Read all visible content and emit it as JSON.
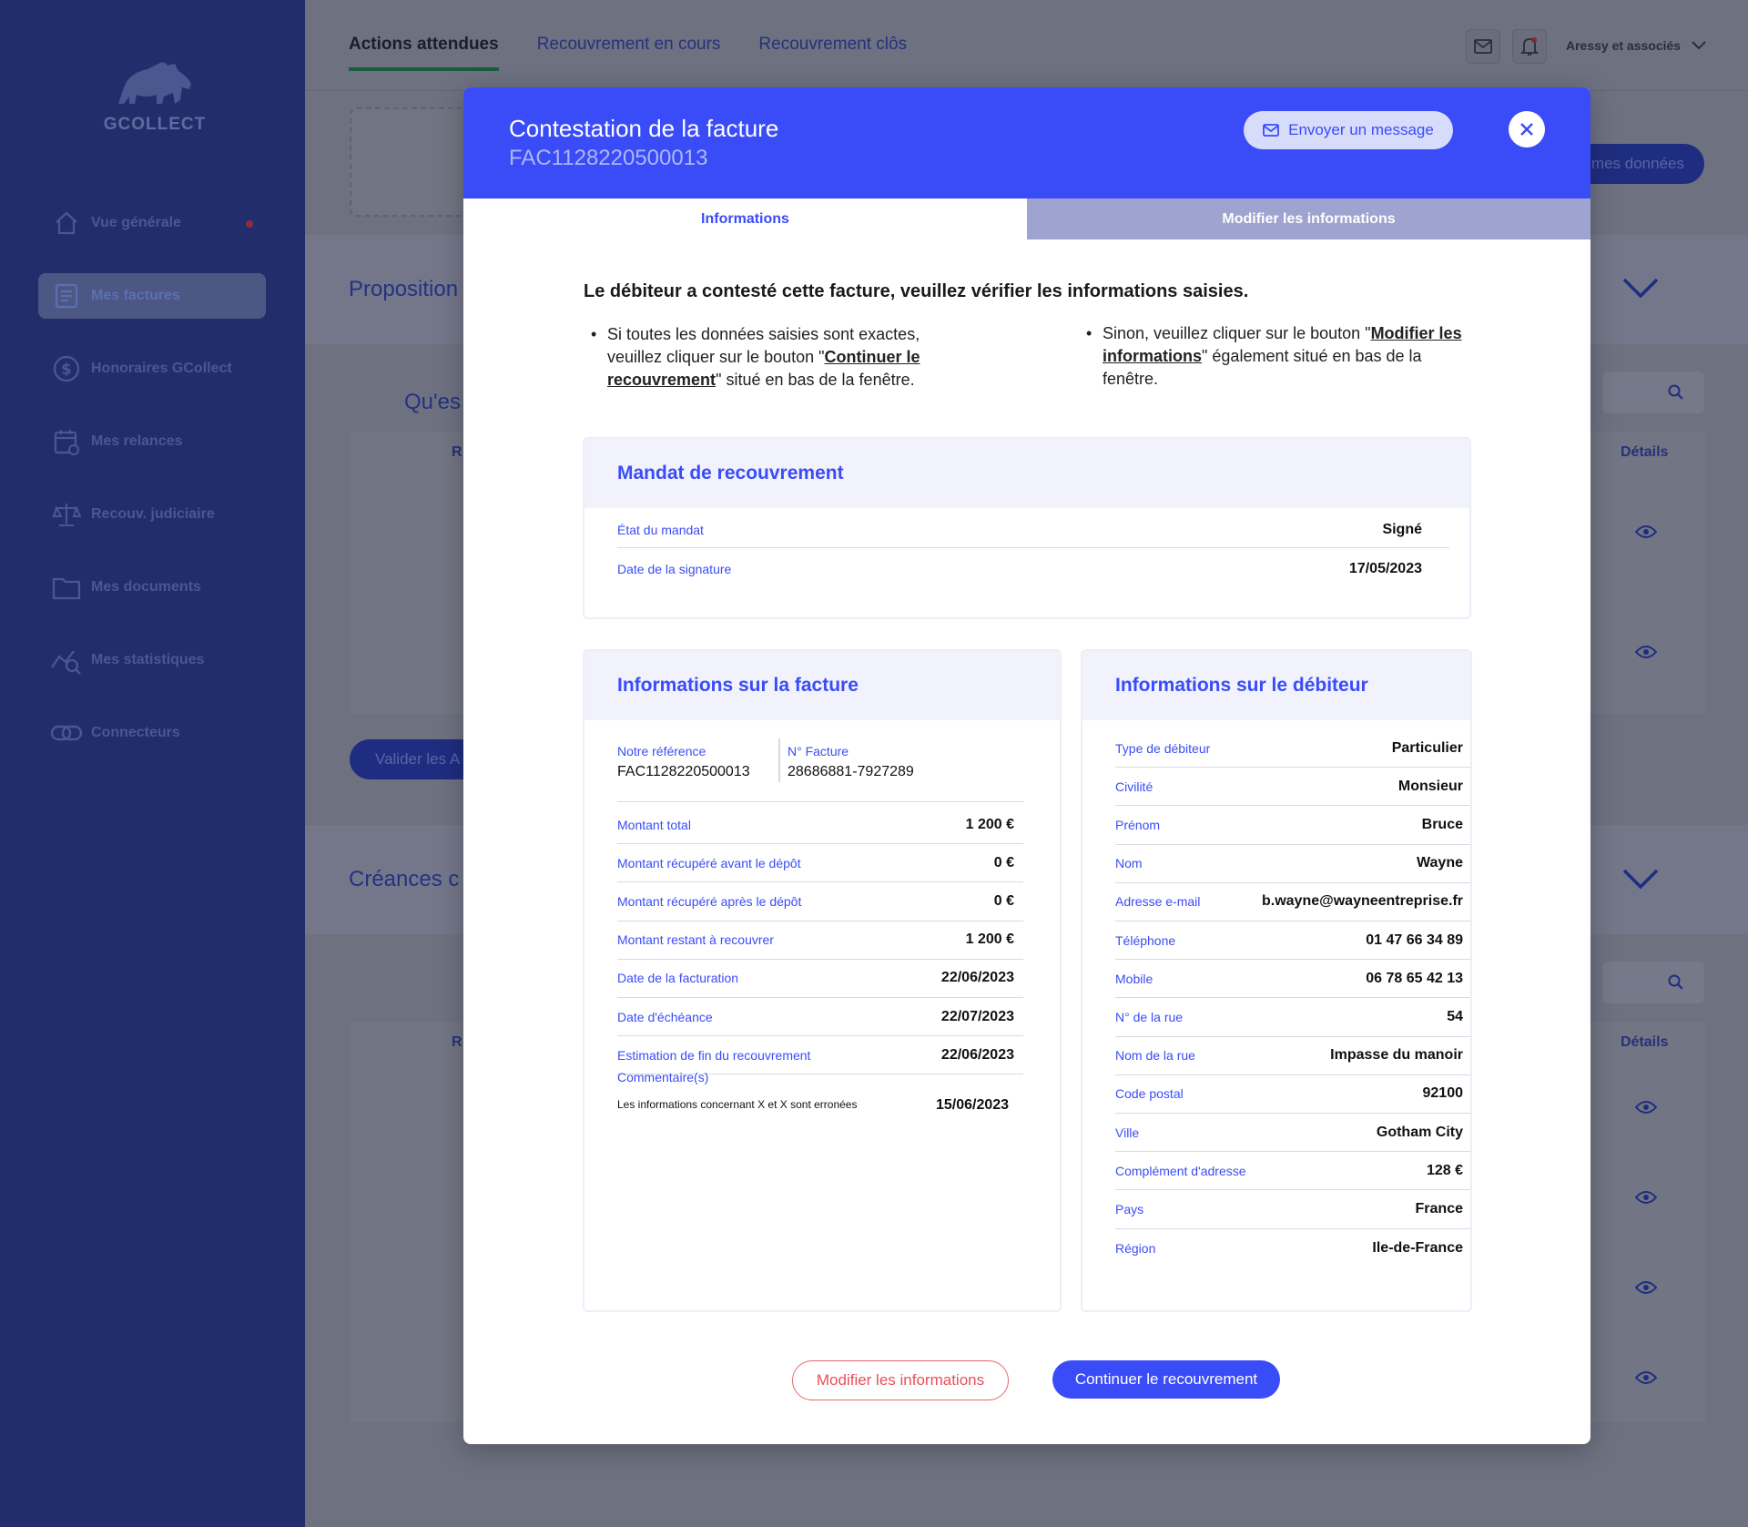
{
  "app": {
    "logo_text": "GCOLLECT"
  },
  "sidebar": {
    "items": [
      {
        "label": "Vue générale",
        "icon": "home-icon"
      },
      {
        "label": "Mes factures",
        "icon": "invoice-icon"
      },
      {
        "label": "Honoraires GCollect",
        "icon": "fees-icon"
      },
      {
        "label": "Mes relances",
        "icon": "calendar-icon"
      },
      {
        "label": "Recouv. judiciaire",
        "icon": "scales-icon"
      },
      {
        "label": "Mes documents",
        "icon": "folder-icon"
      },
      {
        "label": "Mes statistiques",
        "icon": "stats-icon"
      },
      {
        "label": "Connecteurs",
        "icon": "link-icon"
      }
    ]
  },
  "topbar": {
    "tabs": [
      "Actions attendues",
      "Recouvrement en cours",
      "Recouvrement clôs"
    ],
    "user": "Aressy et associés"
  },
  "background": {
    "proposition": "Proposition",
    "question": "Qu'es",
    "creances": "Créances c",
    "valider": "Valider les A",
    "donnees": "mes données",
    "details": "Détails",
    "col_r": "R"
  },
  "modal": {
    "title": "Contestation de la facture",
    "subtitle": "FAC1128220500013",
    "message_button": "Envoyer un message",
    "tabs": {
      "info": "Informations",
      "edit": "Modifier les informations"
    },
    "intro": "Le débiteur a contesté cette facture, veuillez vérifier les informations saisies.",
    "left_bullet": {
      "pre": "Si toutes les données saisies sont exactes, veuillez cliquer sur le bouton \"",
      "link": "Continuer le recouvrement",
      "post": "\" situé en bas de la fenêtre."
    },
    "right_bullet": {
      "pre": "Sinon, veuillez cliquer sur le bouton \"",
      "link": "Modifier les informations",
      "post": "\" également situé en bas de la fenêtre."
    },
    "mandat": {
      "title": "Mandat de recouvrement",
      "rows": [
        {
          "k": "État du mandat",
          "v": "Signé"
        },
        {
          "k": "Date de la signature",
          "v": "17/05/2023"
        }
      ]
    },
    "facture": {
      "title": "Informations sur la facture",
      "ref_label": "Notre référence",
      "ref_value": "FAC1128220500013",
      "num_label": "N° Facture",
      "num_value": "28686881-7927289",
      "rows": [
        {
          "k": "Montant total",
          "v": "1 200 €"
        },
        {
          "k": "Montant récupéré avant le dépôt",
          "v": "0 €"
        },
        {
          "k": "Montant récupéré après le dépôt",
          "v": "0 €"
        },
        {
          "k": "Montant restant à recouvrer",
          "v": "1 200 €"
        },
        {
          "k": "Date de la facturation",
          "v": "22/06/2023"
        },
        {
          "k": "Date d'échéance",
          "v": "22/07/2023"
        },
        {
          "k": "Estimation de fin du recouvrement",
          "v": "22/06/2023"
        }
      ],
      "comment_label": "Commentaire(s)",
      "comment_text": "Les informations concernant X et X sont erronées",
      "comment_date": "15/06/2023"
    },
    "debiteur": {
      "title": "Informations sur le débiteur",
      "rows": [
        {
          "k": "Type de débiteur",
          "v": "Particulier"
        },
        {
          "k": "Civilité",
          "v": "Monsieur"
        },
        {
          "k": "Prénom",
          "v": "Bruce"
        },
        {
          "k": "Nom",
          "v": "Wayne"
        },
        {
          "k": "Adresse e-mail",
          "v": "b.wayne@wayneentreprise.fr"
        },
        {
          "k": "Téléphone",
          "v": "01 47 66 34 89"
        },
        {
          "k": "Mobile",
          "v": "06 78 65 42 13"
        },
        {
          "k": "N° de la rue",
          "v": "54"
        },
        {
          "k": "Nom de la rue",
          "v": "Impasse du manoir"
        },
        {
          "k": "Code postal",
          "v": "92100"
        },
        {
          "k": "Ville",
          "v": "Gotham City"
        },
        {
          "k": "Complément d'adresse",
          "v": "128 €"
        },
        {
          "k": "Pays",
          "v": "France"
        },
        {
          "k": "Région",
          "v": "Ile-de-France"
        }
      ]
    },
    "footer": {
      "modify": "Modifier les informations",
      "continue": "Continuer le recouvrement"
    }
  },
  "colors": {
    "primary": "#3a4cf7",
    "danger": "#e9505a",
    "sidebar": "#222e6b"
  }
}
